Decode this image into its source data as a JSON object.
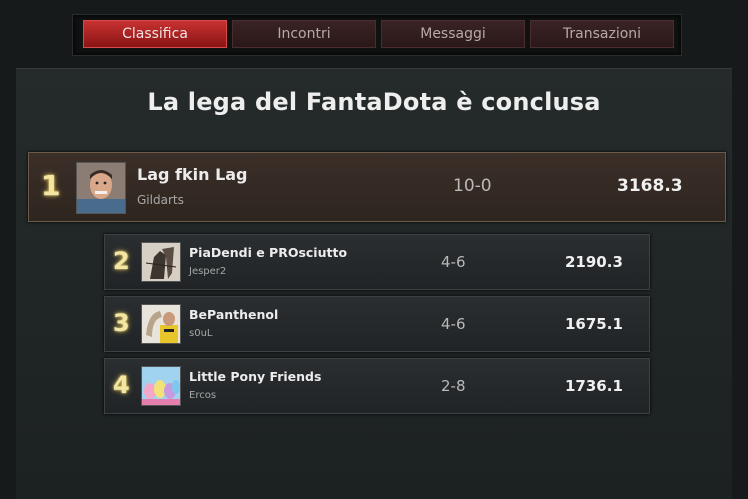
{
  "tabs": [
    {
      "label": "Classifica",
      "active": true
    },
    {
      "label": "Incontri",
      "active": false
    },
    {
      "label": "Messaggi",
      "active": false
    },
    {
      "label": "Transazioni",
      "active": false
    }
  ],
  "title": "La lega del FantaDota è conclusa",
  "standings": [
    {
      "rank": "1",
      "team": "Lag fkin Lag",
      "owner": "Gildarts",
      "record": "10-0",
      "points": "3168.3",
      "avatar": "avatar-sheldon"
    },
    {
      "rank": "2",
      "team": "PiaDendi e PROsciutto",
      "owner": "Jesper2",
      "record": "4-6",
      "points": "2190.3",
      "avatar": "avatar-sketch"
    },
    {
      "rank": "3",
      "team": "BePanthenol",
      "owner": "s0uL",
      "record": "4-6",
      "points": "1675.1",
      "avatar": "avatar-yellow"
    },
    {
      "rank": "4",
      "team": "Little Pony Friends",
      "owner": "Ercos",
      "record": "2-8",
      "points": "1736.1",
      "avatar": "avatar-ponies"
    }
  ],
  "colors": {
    "active_tab": "#c83232",
    "first_row_bg": "#3b2f28",
    "rank_glow": "#f3e6a3"
  }
}
